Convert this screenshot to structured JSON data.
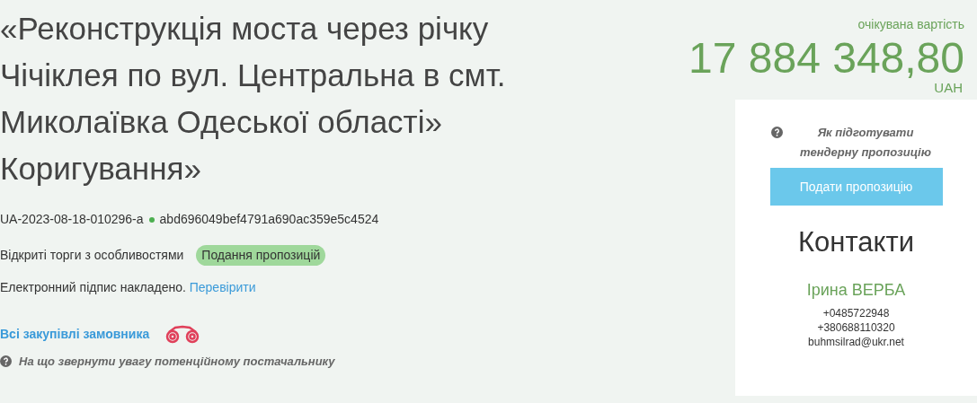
{
  "title": "«Реконструкція моста через річку Чічіклея по вул. Центральна в смт. Миколаївка Одеської області» Коригування»",
  "ids": {
    "tender_id": "UA-2023-08-18-010296-a",
    "hash": "abd696049bef4791a690ac359e5c4524"
  },
  "procedure": {
    "type": "Відкриті торги з особливостями",
    "status": "Подання пропозицій"
  },
  "signature": {
    "text": "Електронний підпис накладено.",
    "link": "Перевірити"
  },
  "buyer_link": "Всі закупівлі замовника",
  "hint": "На що звернути увагу потенційному постачальнику",
  "price": {
    "label": "очікувана вартість",
    "amount": "17 884 348,80",
    "currency": "UAH"
  },
  "sidebar": {
    "hint": "Як підготувати тендерну пропозицію",
    "button": "Подати пропозицію",
    "contacts_title": "Контакти",
    "name": "Ірина ВЕРБА",
    "phones": [
      "+0485722948",
      "+380688110320"
    ],
    "email": "buhmsilrad@ukr.net"
  }
}
